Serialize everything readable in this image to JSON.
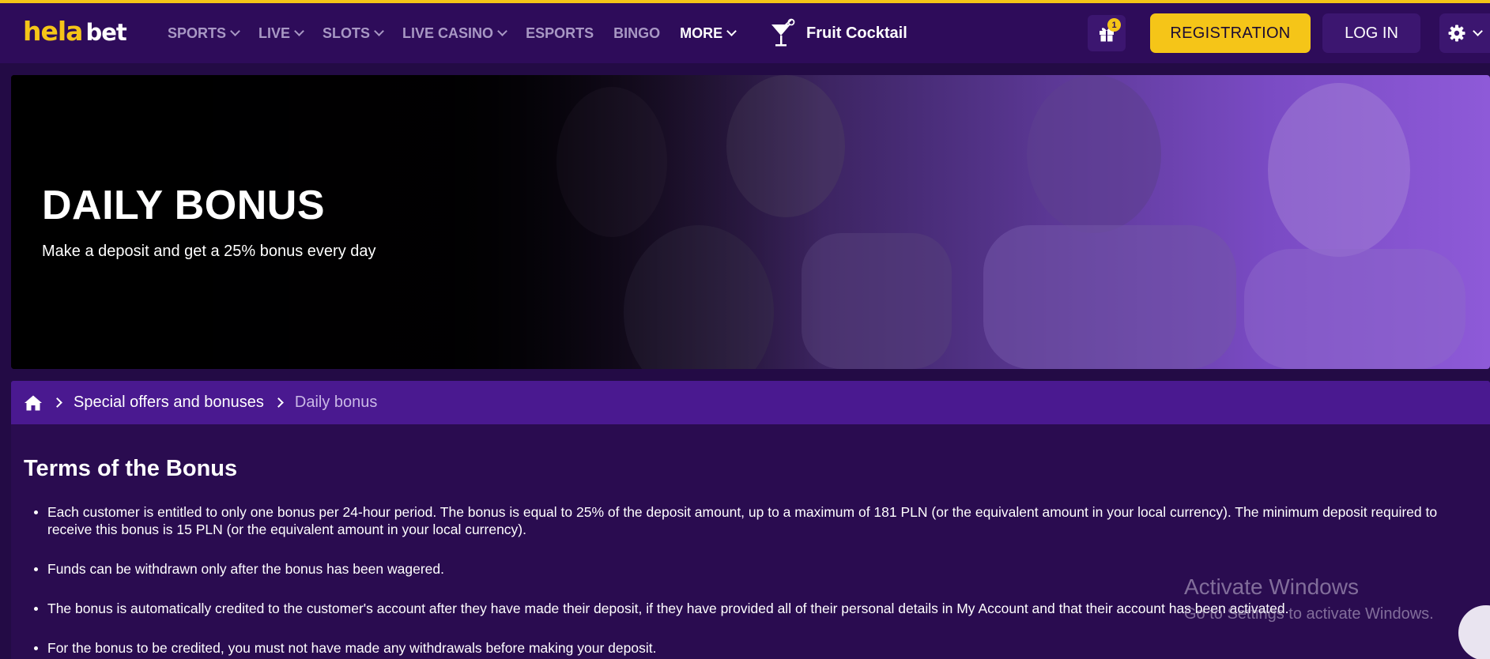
{
  "brand": {
    "logo_part1": "hela",
    "logo_part2": "bet",
    "accent": "#f5c518",
    "header_bg": "#2e0c5a",
    "page_bg": "#230b45"
  },
  "nav": {
    "items": [
      {
        "label": "SPORTS",
        "has_dropdown": true
      },
      {
        "label": "LIVE",
        "has_dropdown": true
      },
      {
        "label": "SLOTS",
        "has_dropdown": true
      },
      {
        "label": "LIVE CASINO",
        "has_dropdown": true
      },
      {
        "label": "ESPORTS",
        "has_dropdown": false
      },
      {
        "label": "BINGO",
        "has_dropdown": false
      },
      {
        "label": "MORE",
        "has_dropdown": true
      }
    ],
    "featured_game": {
      "label": "Fruit Cocktail",
      "icon": "cocktail-glass-icon"
    }
  },
  "header_actions": {
    "gift_badge": "1",
    "gift_icon": "gift-icon",
    "registration": "REGISTRATION",
    "login": "LOG IN",
    "settings_icon": "gear-icon"
  },
  "hero": {
    "title": "DAILY BONUS",
    "subtitle": "Make a deposit and get a 25% bonus every day"
  },
  "breadcrumb": {
    "home_icon": "home-icon",
    "items": [
      "Special offers and bonuses",
      "Daily bonus"
    ]
  },
  "content": {
    "title": "Terms of the Bonus",
    "terms": [
      "Each customer is entitled to only one bonus per 24-hour period. The bonus is equal to 25% of the deposit amount, up to a maximum of 181 PLN (or the equivalent amount in your local currency). The minimum deposit required to receive this bonus is 15 PLN (or the equivalent amount in your local currency).",
      "Funds can be withdrawn only after the bonus has been wagered.",
      "The bonus is automatically credited to the customer's account after they have made their deposit, if they have provided all of their personal details in My Account and that their account has been activated.",
      "For the bonus to be credited, you must not have made any withdrawals before making your deposit."
    ]
  },
  "watermark": {
    "title": "Activate Windows",
    "subtitle": "Go to Settings to activate Windows."
  }
}
